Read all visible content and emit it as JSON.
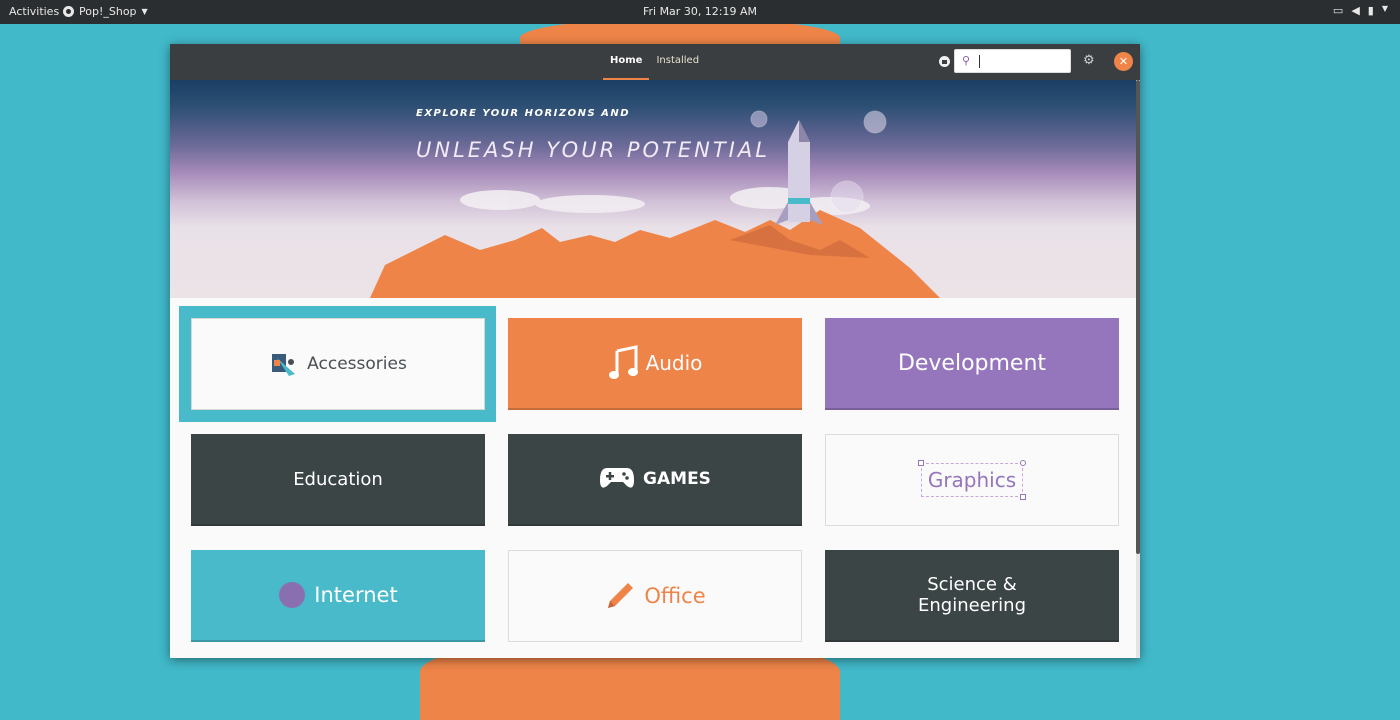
{
  "topbar": {
    "activities": "Activities",
    "app_name": "Pop!_Shop",
    "clock": "Fri Mar 30, 12:19 AM"
  },
  "headerbar": {
    "tabs": [
      {
        "label": "Home",
        "active": true
      },
      {
        "label": "Installed",
        "active": false
      }
    ],
    "search": {
      "value": "",
      "placeholder": ""
    }
  },
  "banner": {
    "subtitle": "EXPLORE YOUR HORIZONS AND",
    "title": "UNLEASH YOUR POTENTIAL"
  },
  "categories": [
    {
      "label": "Accessories",
      "selected": true
    },
    {
      "label": "Audio"
    },
    {
      "label": "Development"
    },
    {
      "label": "Education"
    },
    {
      "label": "GAMES"
    },
    {
      "label": "Graphics"
    },
    {
      "label": "Internet"
    },
    {
      "label": "Office"
    },
    {
      "label": "Science &\nEngineering"
    }
  ],
  "colors": {
    "accent": "#ef8449",
    "teal": "#48bac9",
    "purple": "#9576bc",
    "dark": "#3c4546"
  }
}
